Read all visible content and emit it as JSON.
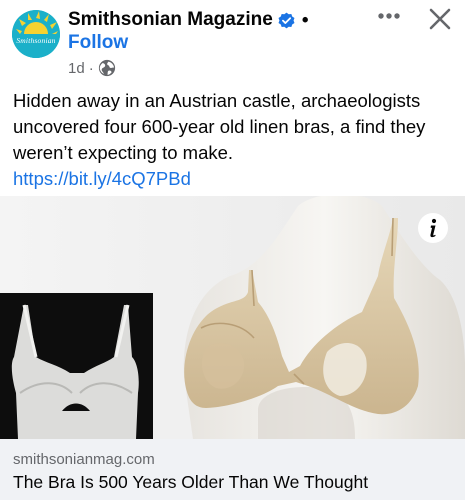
{
  "page": {
    "name": "Smithsonian Magazine",
    "avatar_text": "Smithsonian",
    "follow_label": "Follow",
    "timestamp": "1d",
    "separator": "·",
    "dot": "•",
    "privacy_icon": "globe-icon",
    "verified_icon": "verified-badge-icon"
  },
  "actions": {
    "more_icon": "more-options-icon",
    "close_icon": "close-icon"
  },
  "post": {
    "text": "Hidden away in an Austrian castle, archaeologists uncovered four 600-year old linen bras, a find they weren’t expecting to make.",
    "link": "https://bit.ly/4cQ7PBd"
  },
  "link_preview": {
    "domain": "smithsonianmag.com",
    "headline": "The Bra Is 500 Years Older Than We Thought",
    "info_icon": "info-icon"
  },
  "colors": {
    "link_blue": "#1b74e4",
    "meta_gray": "#65676b",
    "preview_bg": "#f0f2f5",
    "avatar_teal": "#1bb0c9",
    "avatar_sun": "#f6d231"
  }
}
